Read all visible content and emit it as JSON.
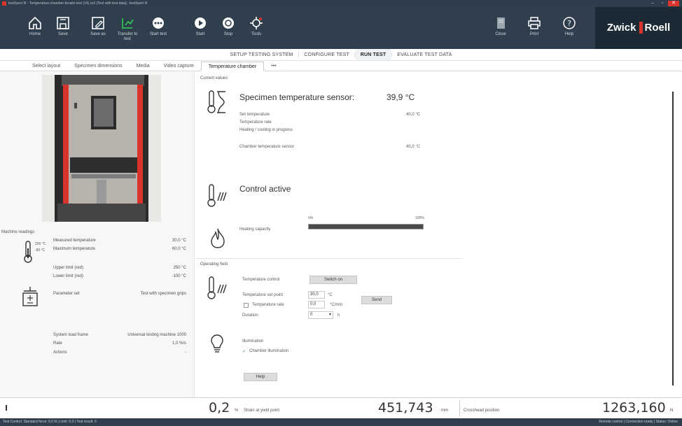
{
  "window": {
    "title": "testXpert III - Temperature-chamber-tensile-test (14).zs2 [Test with test data] - testXpert III",
    "minimize": "–",
    "maximize": "▫",
    "close": "✕"
  },
  "ribbon": {
    "buttons": [
      {
        "label": "Home",
        "icon": "home-icon"
      },
      {
        "label": "Save",
        "icon": "save-icon"
      },
      {
        "label": "Save as",
        "icon": "save-as-icon"
      },
      {
        "label": "Transfer to test",
        "icon": "transfer-icon"
      },
      {
        "label": "Start test",
        "icon": "start-test-icon"
      },
      {
        "label": "Start",
        "icon": "play-icon"
      },
      {
        "label": "Stop",
        "icon": "stop-icon"
      },
      {
        "label": "Tools",
        "icon": "tools-icon"
      }
    ],
    "right_buttons": [
      {
        "label": "Close",
        "icon": "document-icon"
      },
      {
        "label": "Print",
        "icon": "print-icon"
      },
      {
        "label": "Help",
        "icon": "help-icon"
      }
    ],
    "logo_left": "Zwick",
    "logo_right": "Roell"
  },
  "workflow": {
    "steps": [
      "SETUP TESTING SYSTEM",
      "CONFIGURE TEST",
      "RUN TEST",
      "EVALUATE TEST DATA"
    ],
    "active_index": 2,
    "separator": "|"
  },
  "tabs": [
    "Select layout",
    "Specimen dimensions",
    "Media",
    "Video capture",
    "Temperature chamber",
    "•••"
  ],
  "active_tab": 4,
  "left": {
    "section_title": "Machine readings",
    "readings": [
      {
        "label": "Measured temperature",
        "value": "30,0 °C"
      },
      {
        "label": "Maximum temperature",
        "value": "60,0 °C"
      },
      {
        "label": "Upper limit (red)",
        "value": "250 °C"
      },
      {
        "label": "Lower limit (red)",
        "value": "-100 °C"
      },
      {
        "label": "Parameter set",
        "value": "Test with specimen grips"
      },
      {
        "label": "System load frame",
        "value": "Universal testing machine 1000"
      },
      {
        "label": "Rate",
        "value": "1,0 %/s"
      },
      {
        "label": "Actions",
        "value": "-"
      }
    ],
    "thermo_scale_top": "200 °C",
    "thermo_scale_bottom": "-80 °C"
  },
  "main": {
    "current_values_title": "Current values",
    "specimen_sensor_label": "Specimen temperature sensor:",
    "specimen_sensor_value": "39,9 °C",
    "details": [
      {
        "label": "Set temperature",
        "value": "40,0 °C"
      },
      {
        "label": "Temperature rate",
        "value": ""
      },
      {
        "label": "Heating / cooling in progress",
        "value": ""
      },
      {
        "label": "Chamber temperature sensor",
        "value": "40,0 °C"
      }
    ],
    "control_active": "Control active",
    "heating_bar_min": "0%",
    "heating_bar_max": "100%",
    "heating_label": "Heating capacity",
    "heating_level": 1.0,
    "control_panel_title": "Operating field",
    "temp_control_label": "Temperature control",
    "temp_control_button": "Switch on",
    "temp_setpoint_label": "Temperature set point",
    "temp_setpoint_value": "30,0",
    "temp_setpoint_unit": "°C",
    "temp_rate_label": "Temperature rate",
    "temp_rate_value": "0,0",
    "temp_rate_unit": "°C/min",
    "set_button": "Send",
    "duration_label": "Duration",
    "duration_value": "0",
    "duration_unit": "h",
    "illumination_label": "Illumination",
    "illumination_check": "Chamber illumination",
    "help_button": "Help"
  },
  "bottom": {
    "display1_value": "0,2",
    "display1_unit": "%",
    "display1_desc": "Strain at yield point",
    "display2_value": "451,743",
    "display2_unit": "mm",
    "display2_desc": "Crosshead position",
    "display3_value": "1263,160",
    "display3_unit": "N"
  },
  "status": {
    "left": "Test Control: Standard force: 0,0 N | Limit: 0,0 | Test result: 0",
    "right": "Remote control  |  Connection ready  |  Status: Online"
  },
  "colors": {
    "ribbon": "#2f3f4d",
    "accent_red": "#d9342b",
    "heating_bar": "#4a4a4a",
    "ribbon_green": "#2fbf52"
  }
}
